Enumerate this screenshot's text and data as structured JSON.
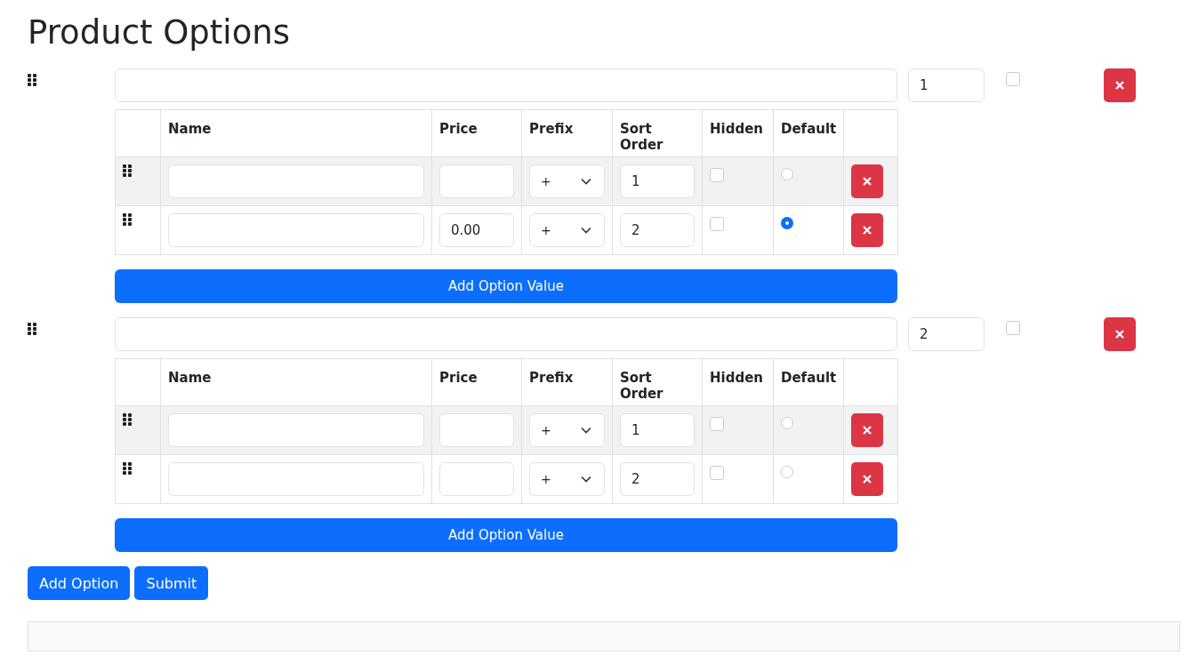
{
  "title": "Product Options",
  "options": [
    {
      "sort_order": "1",
      "hidden": false,
      "columns": [
        "Name",
        "Price",
        "Prefix",
        "Sort Order",
        "Hidden",
        "Default"
      ],
      "values": [
        {
          "prefix": "+",
          "sort_order": "1",
          "hidden": false,
          "selected": false
        },
        {
          "price": "0.00",
          "prefix": "+",
          "sort_order": "2",
          "hidden": false,
          "selected": true
        }
      ],
      "add_button": "Add Option Value"
    },
    {
      "sort_order": "2",
      "hidden": false,
      "columns": [
        "Name",
        "Price",
        "Prefix",
        "Sort Order",
        "Hidden",
        "Default"
      ],
      "values": [
        {
          "prefix": "+",
          "sort_order": "1",
          "hidden": false,
          "selected": false
        },
        {
          "prefix": "+",
          "sort_order": "2",
          "hidden": false,
          "selected": false
        }
      ],
      "add_button": "Add Option Value"
    }
  ],
  "buttons": [
    "Add Option",
    "Submit"
  ]
}
